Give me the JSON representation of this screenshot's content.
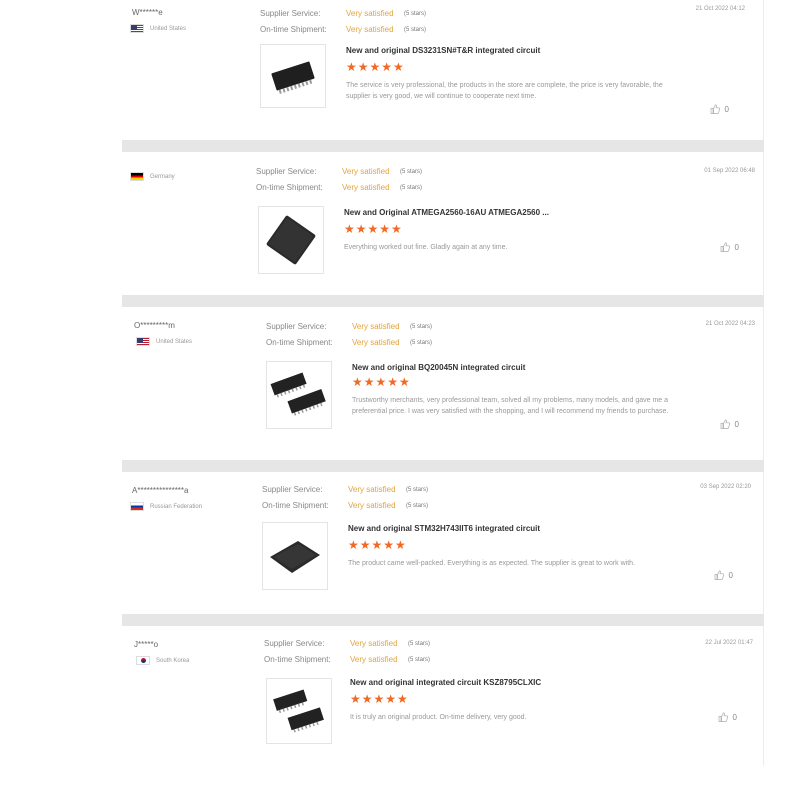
{
  "labels": {
    "supplier_service": "Supplier Service:",
    "on_time_shipment": "On-time Shipment:"
  },
  "reviews": [
    {
      "user": "W******e",
      "country": "United States",
      "flag": "us",
      "supplier_rating": "Very satisfied",
      "supplier_stars": "(5 stars)",
      "shipment_rating": "Very satisfied",
      "shipment_stars": "(5 stars)",
      "date": "21 Oct 2022 04:12",
      "product_title": "New and original DS3231SN#T&R integrated circuit",
      "stars": "★★★★★",
      "text": "The service is very professional, the products in the store are complete, the price is very favorable, the supplier is very good, we will continue to cooperate next time.",
      "likes": "0",
      "chip": "soic"
    },
    {
      "user": "",
      "country": "Germany",
      "flag": "de",
      "supplier_rating": "Very satisfied",
      "supplier_stars": "(5 stars)",
      "shipment_rating": "Very satisfied",
      "shipment_stars": "(5 stars)",
      "date": "01 Sep 2022 06:48",
      "product_title": "New and Original ATMEGA2560-16AU ATMEGA2560 ...",
      "stars": "★★★★★",
      "text": "Everything worked out fine. Gladly again at any time.",
      "likes": "0",
      "chip": "qfp"
    },
    {
      "user": "O*********m",
      "country": "United States",
      "flag": "us",
      "supplier_rating": "Very satisfied",
      "supplier_stars": "(5 stars)",
      "shipment_rating": "Very satisfied",
      "shipment_stars": "(5 stars)",
      "date": "21 Oct 2022 04:23",
      "product_title": "New and original BQ20045N integrated circuit",
      "stars": "★★★★★",
      "text": "Trustworthy merchants, very professional team, solved all my problems, many models, and gave me a preferential price. I was very satisfied with the shopping, and I will recommend my friends to purchase.",
      "likes": "0",
      "chip": "tssop2"
    },
    {
      "user": "A***************a",
      "country": "Russian Federation",
      "flag": "ru",
      "supplier_rating": "Very satisfied",
      "supplier_stars": "(5 stars)",
      "shipment_rating": "Very satisfied",
      "shipment_stars": "(5 stars)",
      "date": "03 Sep 2022 02:20",
      "product_title": "New and original STM32H743IIT6 integrated circuit",
      "stars": "★★★★★",
      "text": "The product came well-packed. Everything is as expected. The supplier is great to work with.",
      "likes": "0",
      "chip": "lqfp"
    },
    {
      "user": "J*****o",
      "country": "South Korea",
      "flag": "kr",
      "supplier_rating": "Very satisfied",
      "supplier_stars": "(5 stars)",
      "shipment_rating": "Very satisfied",
      "shipment_stars": "(5 stars)",
      "date": "22 Jul 2022 01:47",
      "product_title": "New and original integrated circuit KSZ8795CLXIC",
      "stars": "★★★★★",
      "text": "It is truly an original product. On-time delivery, very good.",
      "likes": "0",
      "chip": "tssop2"
    }
  ]
}
